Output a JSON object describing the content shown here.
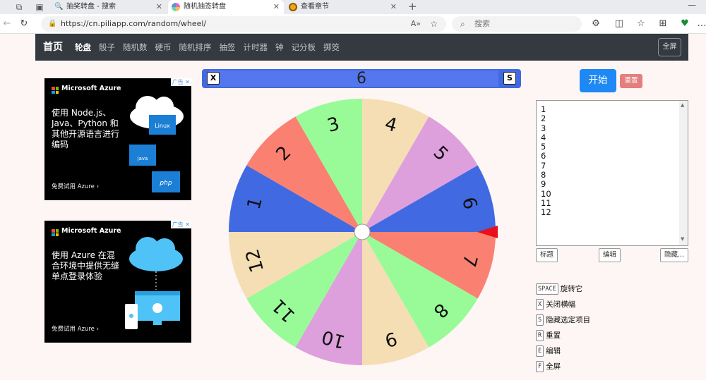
{
  "browser": {
    "tabs": [
      {
        "title": "抽奖转盘 - 搜索",
        "favicon_color": "#2b6de0"
      },
      {
        "title": "随机抽签转盘",
        "favicon_color": "#d86ad8"
      },
      {
        "title": "查看章节",
        "favicon_color": "#f2a413"
      }
    ],
    "new_tab": "+",
    "url": "https://cn.piliapp.com/random/wheel/",
    "search_placeholder": "搜索",
    "close_glyph": "✕"
  },
  "nav": {
    "brand": "首页",
    "links": [
      "轮盘",
      "骰子",
      "随机数",
      "硬币",
      "随机排序",
      "抽签",
      "计时器",
      "钟",
      "记分板",
      "掷筊"
    ],
    "fullscreen": "全屏"
  },
  "ads": [
    {
      "tag": "广告",
      "brand": "Microsoft Azure",
      "text": "使用 Node.js、Java、Python 和其他开源语言进行编码",
      "cta": "免费试用 Azure  ›",
      "badge1": "Linux",
      "badge2": "java",
      "badge3": "php"
    },
    {
      "tag": "广告",
      "brand": "Microsoft Azure",
      "text": "使用 Azure 在混合环境中提供无缝单点登录体验",
      "cta": "免费试用 Azure  ›"
    }
  ],
  "result": {
    "value": "6",
    "key_x": "X",
    "key_s": "S"
  },
  "wheel": {
    "items": [
      "1",
      "2",
      "3",
      "4",
      "5",
      "6",
      "7",
      "8",
      "9",
      "10",
      "11",
      "12"
    ],
    "colors": [
      "#4169e1",
      "#fa8072",
      "#98fb98",
      "#f5deb3",
      "#dda0dd",
      "#4169e1",
      "#fa8072",
      "#98fb98",
      "#f5deb3",
      "#dda0dd",
      "#98fb98",
      "#f5deb3"
    ],
    "pointer_color": "#e8101a"
  },
  "controls": {
    "start": "开始",
    "reset": "重置",
    "title_btn": "标题",
    "edit_btn": "编辑",
    "hide_btn": "隐藏..."
  },
  "shortcuts": [
    {
      "key": "SPACE",
      "label": "旋转它"
    },
    {
      "key": "X",
      "label": "关闭横幅"
    },
    {
      "key": "S",
      "label": "隐藏选定项目"
    },
    {
      "key": "R",
      "label": "重置"
    },
    {
      "key": "E",
      "label": "编辑"
    },
    {
      "key": "F",
      "label": "全屏"
    }
  ]
}
